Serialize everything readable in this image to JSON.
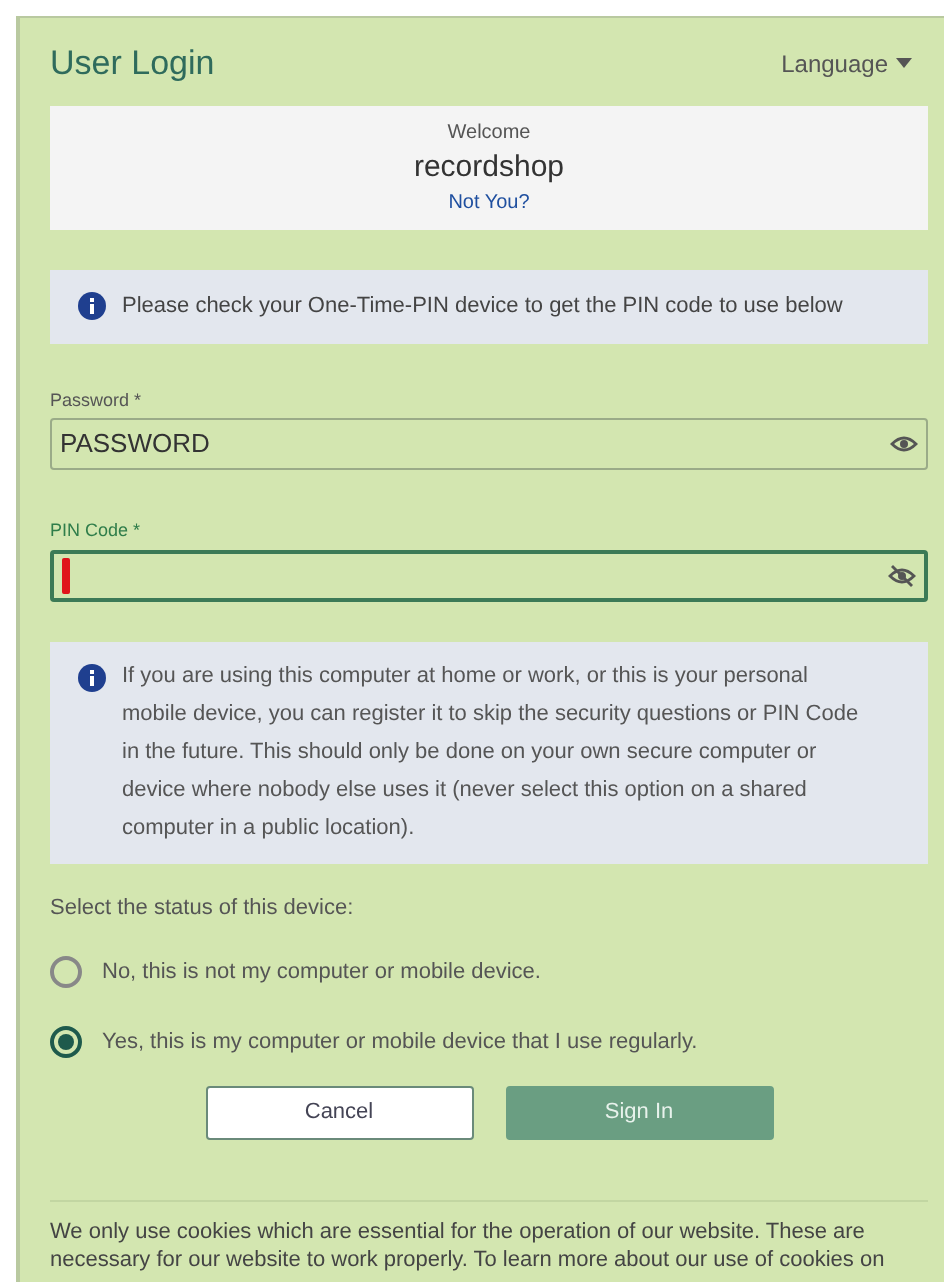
{
  "header": {
    "title": "User Login",
    "language": "Language"
  },
  "welcome": {
    "greeting": "Welcome",
    "username": "recordshop",
    "link": "Not You?"
  },
  "notice": "Please check your One-Time-PIN device to get the PIN code to use below",
  "fields": [
    {
      "label": "Password *",
      "value": "PASSWORD",
      "focused": false,
      "reveal": true
    },
    {
      "label": "PIN Code *",
      "focused": true,
      "reveal": false
    }
  ],
  "info": "If you are using this computer at home or work, or this is your personal mobile device, you can register it to skip the security questions or PIN Code in the future. This should only be done on your own secure computer or device where nobody else uses it (never select this option on a shared computer in a public location).",
  "device_prompt": "Select the status of this device:",
  "options": [
    {
      "label": "No, this is not my computer or mobile device.",
      "selected": false
    },
    {
      "label": "Yes, this is my computer or mobile device that I use regularly.",
      "selected": true
    }
  ],
  "buttons": [
    {
      "label": "Cancel",
      "kind": "secondary"
    },
    {
      "label": "Sign In",
      "kind": "primary"
    }
  ],
  "cookies": "We only use cookies which are essential for the operation of our website. These are necessary for our website to work properly. To learn more about our use of cookies on"
}
